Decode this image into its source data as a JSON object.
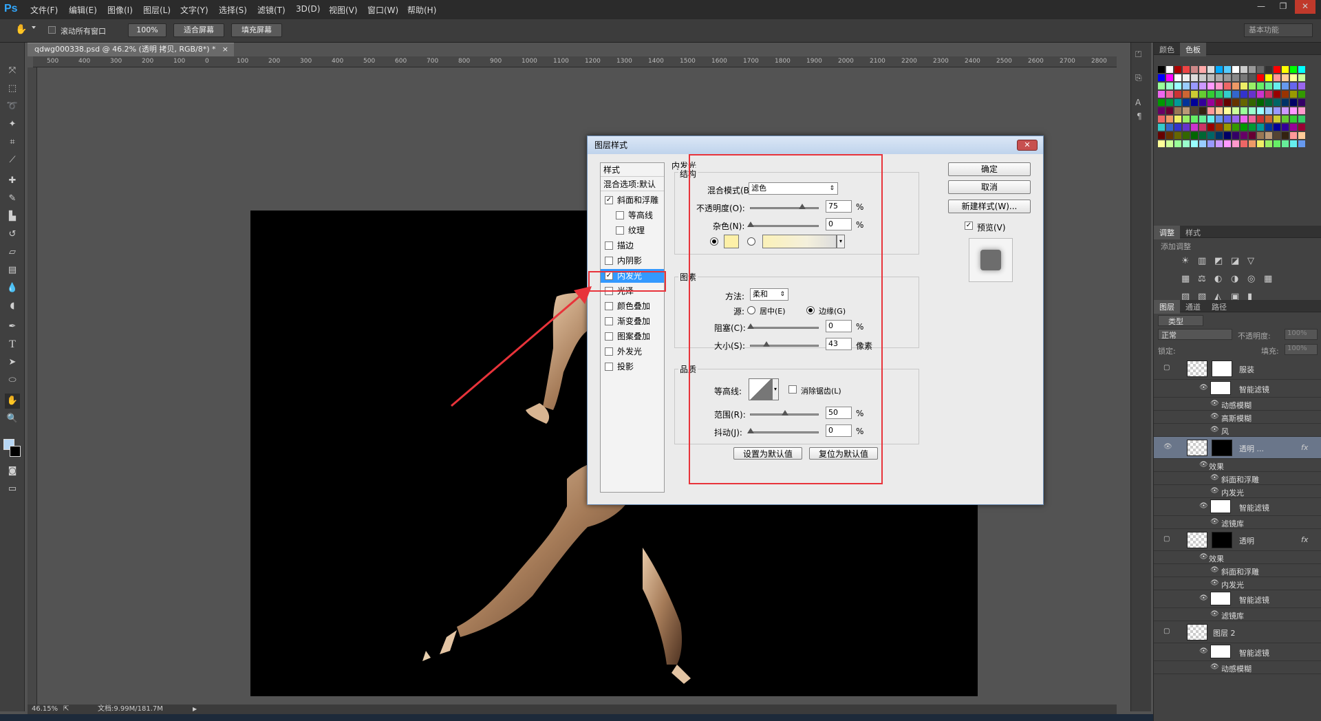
{
  "app": {
    "logo": "Ps"
  },
  "menu": [
    "文件(F)",
    "编辑(E)",
    "图像(I)",
    "图层(L)",
    "文字(Y)",
    "选择(S)",
    "滤镜(T)",
    "3D(D)",
    "视图(V)",
    "窗口(W)",
    "帮助(H)"
  ],
  "window_buttons": [
    "—",
    "❐",
    "✕"
  ],
  "options": {
    "scroll_all": "滚动所有窗口",
    "zoom_btn": "100%",
    "fit_btn": "适合屏幕",
    "fill_btn": "填充屏幕",
    "workspace": "基本功能"
  },
  "doc": {
    "tab": "qdwg000338.psd @ 46.2% (透明 拷贝, RGB/8*) *",
    "zoom": "46.15%",
    "info": "文档:9.99M/181.7M"
  },
  "ruler_h": [
    "500",
    "400",
    "300",
    "200",
    "100",
    "0",
    "100",
    "200",
    "300",
    "400",
    "500",
    "600",
    "700",
    "800",
    "900",
    "1000",
    "1100",
    "1200",
    "1300",
    "1400",
    "1500",
    "1600",
    "1700",
    "1800",
    "1900",
    "2000",
    "2100",
    "2200",
    "2300",
    "2400",
    "2500",
    "2600",
    "2700",
    "2800"
  ],
  "right_panels": {
    "color_tabs": [
      "颜色",
      "色板"
    ],
    "adjust_tabs": [
      "调整",
      "样式"
    ],
    "adjust_label": "添加调整",
    "layers_tabs": [
      "图层",
      "通道",
      "路径"
    ],
    "kind": "类型",
    "blend": "正常",
    "opacity_label": "不透明度:",
    "opacity": "100%",
    "lock_label": "锁定:",
    "fill_label": "填充:",
    "fill": "100%"
  },
  "layers": [
    {
      "name": "服装",
      "kind": "layer"
    },
    {
      "name": "智能滤镜",
      "kind": "sub"
    },
    {
      "name": "动感模糊",
      "kind": "subsub"
    },
    {
      "name": "高斯模糊",
      "kind": "subsub"
    },
    {
      "name": "风",
      "kind": "subsub"
    },
    {
      "name": "透明 ...",
      "kind": "layer-sel"
    },
    {
      "name": "效果",
      "kind": "sub"
    },
    {
      "name": "斜面和浮雕",
      "kind": "subsub"
    },
    {
      "name": "内发光",
      "kind": "subsub"
    },
    {
      "name": "智能滤镜",
      "kind": "sub"
    },
    {
      "name": "滤镜库",
      "kind": "subsub"
    },
    {
      "name": "透明",
      "kind": "layer"
    },
    {
      "name": "效果",
      "kind": "sub"
    },
    {
      "name": "斜面和浮雕",
      "kind": "subsub"
    },
    {
      "name": "内发光",
      "kind": "subsub"
    },
    {
      "name": "智能滤镜",
      "kind": "sub"
    },
    {
      "name": "滤镜库",
      "kind": "subsub"
    },
    {
      "name": "图层 2",
      "kind": "layer"
    },
    {
      "name": "智能滤镜",
      "kind": "sub"
    },
    {
      "name": "动感模糊",
      "kind": "subsub"
    }
  ],
  "dialog": {
    "title": "图层样式",
    "close": "✕",
    "styles_header": "样式",
    "blend_default": "混合选项:默认",
    "style_items": [
      {
        "label": "斜面和浮雕",
        "checked": true
      },
      {
        "label": "等高线",
        "checked": false
      },
      {
        "label": "纹理",
        "checked": false
      },
      {
        "label": "描边",
        "checked": false
      },
      {
        "label": "内阴影",
        "checked": false
      },
      {
        "label": "内发光",
        "checked": true
      },
      {
        "label": "光泽",
        "checked": false
      },
      {
        "label": "颜色叠加",
        "checked": false
      },
      {
        "label": "渐变叠加",
        "checked": false
      },
      {
        "label": "图案叠加",
        "checked": false
      },
      {
        "label": "外发光",
        "checked": false
      },
      {
        "label": "投影",
        "checked": false
      }
    ],
    "section_title": "内发光",
    "structure": "结构",
    "blend_mode_label": "混合模式(B):",
    "blend_mode": "滤色",
    "opacity_label": "不透明度(O):",
    "opacity": "75",
    "noise_label": "杂色(N):",
    "noise": "0",
    "percent": "%",
    "elements": "图素",
    "method_label": "方法:",
    "method": "柔和",
    "source_label": "源:",
    "center": "居中(E)",
    "edge": "边缘(G)",
    "choke_label": "阻塞(C):",
    "choke": "0",
    "size_label": "大小(S):",
    "size": "43",
    "px": "像素",
    "quality": "品质",
    "contour_label": "等高线:",
    "antialias": "消除锯齿(L)",
    "range_label": "范围(R):",
    "range": "50",
    "jitter_label": "抖动(J):",
    "jitter": "0",
    "set_default": "设置为默认值",
    "reset_default": "复位为默认值",
    "ok": "确定",
    "cancel": "取消",
    "new_style": "新建样式(W)...",
    "preview": "预览(V)",
    "glow_color": "#fdf0a8"
  }
}
